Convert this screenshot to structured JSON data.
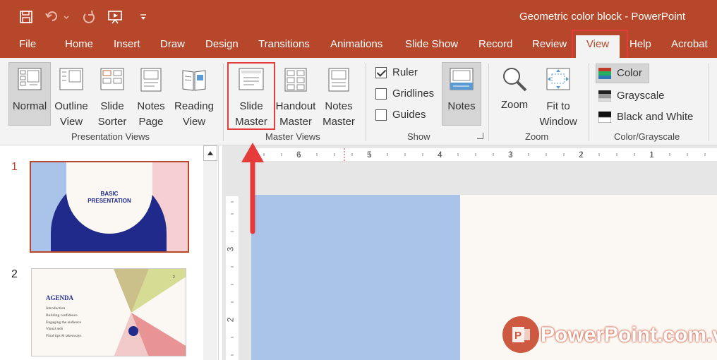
{
  "window": {
    "title": "Geometric color block  -  PowerPoint"
  },
  "tabs": [
    "File",
    "Home",
    "Insert",
    "Draw",
    "Design",
    "Transitions",
    "Animations",
    "Slide Show",
    "Record",
    "Review",
    "View",
    "Help",
    "Acrobat"
  ],
  "ribbon": {
    "presentation_views": {
      "label": "Presentation Views",
      "buttons": [
        {
          "line1": "Normal",
          "line2": ""
        },
        {
          "line1": "Outline",
          "line2": "View"
        },
        {
          "line1": "Slide",
          "line2": "Sorter"
        },
        {
          "line1": "Notes",
          "line2": "Page"
        },
        {
          "line1": "Reading",
          "line2": "View"
        }
      ]
    },
    "master_views": {
      "label": "Master Views",
      "buttons": [
        {
          "line1": "Slide",
          "line2": "Master"
        },
        {
          "line1": "Handout",
          "line2": "Master"
        },
        {
          "line1": "Notes",
          "line2": "Master"
        }
      ]
    },
    "show": {
      "label": "Show",
      "checkboxes": [
        {
          "label": "Ruler",
          "checked": true
        },
        {
          "label": "Gridlines",
          "checked": false
        },
        {
          "label": "Guides",
          "checked": false
        }
      ],
      "notes_button": "Notes"
    },
    "zoom": {
      "label": "Zoom",
      "zoom_button": "Zoom",
      "fit_line1": "Fit to",
      "fit_line2": "Window"
    },
    "color_grayscale": {
      "label": "Color/Grayscale",
      "options": [
        "Color",
        "Grayscale",
        "Black and White"
      ]
    }
  },
  "slides": [
    {
      "number": "1",
      "title_line1": "BASIC",
      "title_line2": "PRESENTATION"
    },
    {
      "number": "2",
      "heading": "AGENDA",
      "page_num": "2",
      "items": [
        "Introduction",
        "Building confidence",
        "Engaging the audience",
        "Visual aids",
        "Final tips & takeaways"
      ]
    }
  ],
  "ruler": {
    "horizontal": [
      "6",
      "5",
      "4",
      "3",
      "2",
      "1"
    ],
    "vertical": [
      "3",
      "2"
    ]
  },
  "watermark": {
    "text": "PowerPoint.com.vn"
  },
  "colors": {
    "accent": "#b7472a",
    "highlight": "#e53b3b",
    "slide_blue": "#aac3e8",
    "slide_navy": "#1f2a8a",
    "slide_pink": "#f5cfd1"
  }
}
